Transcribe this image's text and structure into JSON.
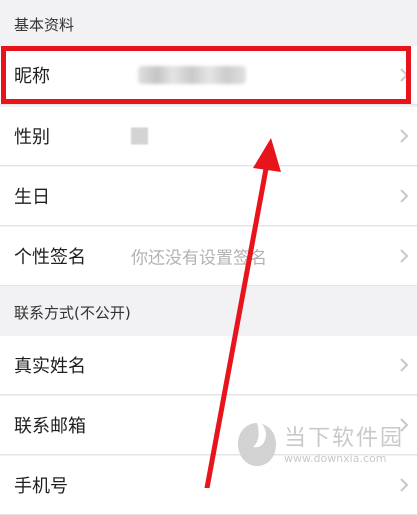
{
  "sections": {
    "basic_info": "基本资料",
    "contact": "联系方式(不公开)"
  },
  "rows": {
    "nickname": {
      "label": "昵称",
      "value": ""
    },
    "gender": {
      "label": "性别",
      "value": ""
    },
    "birthday": {
      "label": "生日",
      "value": ""
    },
    "signature": {
      "label": "个性签名",
      "value": "你还没有设置签名"
    },
    "real_name": {
      "label": "真实姓名",
      "value": ""
    },
    "email": {
      "label": "联系邮箱",
      "value": ""
    },
    "phone": {
      "label": "手机号",
      "value": ""
    }
  },
  "icons": {
    "row_chevron": "chevron-right-icon",
    "watermark_logo": "downxia-logo-icon"
  },
  "watermark": {
    "title": "当下软件园",
    "url": "www.downxia.com"
  },
  "annotation": {
    "highlight_color": "#e8141c",
    "arrow_color": "#e8141c"
  },
  "colors": {
    "background": "#f2f2f4",
    "row_background": "#ffffff",
    "placeholder": "#b2b2b2"
  }
}
